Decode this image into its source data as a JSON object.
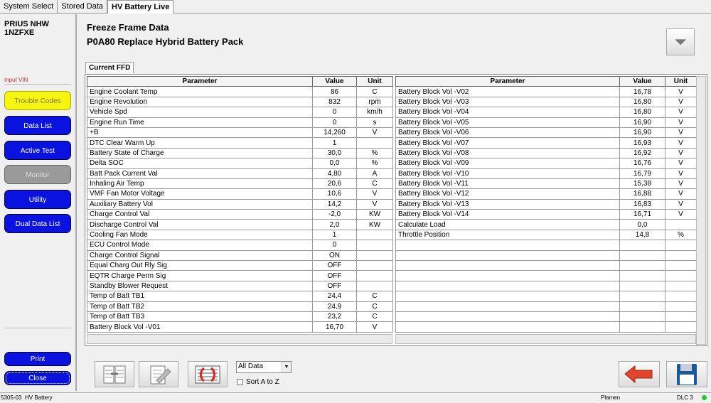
{
  "tabs": [
    {
      "label": "System Select"
    },
    {
      "label": "Stored Data"
    },
    {
      "label": "HV Battery Live",
      "active": true
    }
  ],
  "sidebar": {
    "vehicle_line1": "PRIUS NHW",
    "vehicle_line2": "1NZFXE",
    "input_vin": "Input VIN",
    "buttons": [
      {
        "label": "Trouble Codes",
        "style": "yellow"
      },
      {
        "label": "Data List"
      },
      {
        "label": "Active Test"
      },
      {
        "label": "Monitor",
        "style": "disabled"
      },
      {
        "label": "Utility"
      },
      {
        "label": "Dual Data List"
      }
    ],
    "print": "Print",
    "close": "Close"
  },
  "header": {
    "title": "Freeze Frame Data",
    "subtitle": "P0A80 Replace Hybrid Battery Pack",
    "filter_icon": "funnel-icon"
  },
  "ffd_tab": "Current FFD",
  "columns": {
    "parameter": "Parameter",
    "value": "Value",
    "unit": "Unit"
  },
  "left_rows": [
    [
      "Engine Coolant Temp",
      "86",
      "C"
    ],
    [
      "Engine Revolution",
      "832",
      "rpm"
    ],
    [
      "Vehicle Spd",
      "0",
      "km/h"
    ],
    [
      "Engine Run Time",
      "0",
      "s"
    ],
    [
      "+B",
      "14,260",
      "V"
    ],
    [
      "DTC Clear Warm Up",
      "1",
      ""
    ],
    [
      "Battery State of Charge",
      "30,0",
      "%"
    ],
    [
      "Delta SOC",
      "0,0",
      "%"
    ],
    [
      "Batt Pack Current Val",
      "4,80",
      "A"
    ],
    [
      "Inhaling Air Temp",
      "20,6",
      "C"
    ],
    [
      "VMF Fan Motor Voltage",
      "10,6",
      "V"
    ],
    [
      "Auxiliary Battery Vol",
      "14,2",
      "V"
    ],
    [
      "Charge Control Val",
      "-2,0",
      "KW"
    ],
    [
      "Discharge Control Val",
      "2,0",
      "KW"
    ],
    [
      "Cooling Fan Mode",
      "1",
      ""
    ],
    [
      "ECU Control Mode",
      "0",
      ""
    ],
    [
      "Charge Control Signal",
      "ON",
      ""
    ],
    [
      "Equal Charg Out Rly Sig",
      "OFF",
      ""
    ],
    [
      "EQTR Charge Perm Sig",
      "OFF",
      ""
    ],
    [
      "Standby Blower Request",
      "OFF",
      ""
    ],
    [
      "Temp of Batt TB1",
      "24,4",
      "C"
    ],
    [
      "Temp of Batt TB2",
      "24,9",
      "C"
    ],
    [
      "Temp of Batt TB3",
      "23,2",
      "C"
    ],
    [
      "Battery Block Vol -V01",
      "16,70",
      "V"
    ]
  ],
  "right_rows": [
    [
      "Battery Block Vol -V02",
      "16,78",
      "V"
    ],
    [
      "Battery Block Vol -V03",
      "16,80",
      "V"
    ],
    [
      "Battery Block Vol -V04",
      "16,80",
      "V"
    ],
    [
      "Battery Block Vol -V05",
      "16,90",
      "V"
    ],
    [
      "Battery Block Vol -V06",
      "16,90",
      "V"
    ],
    [
      "Battery Block Vol -V07",
      "16,93",
      "V"
    ],
    [
      "Battery Block Vol -V08",
      "16,92",
      "V"
    ],
    [
      "Battery Block Vol -V09",
      "16,76",
      "V"
    ],
    [
      "Battery Block Vol -V10",
      "16,79",
      "V"
    ],
    [
      "Battery Block Vol -V11",
      "15,38",
      "V"
    ],
    [
      "Battery Block Vol -V12",
      "16,88",
      "V"
    ],
    [
      "Battery Block Vol -V13",
      "16,83",
      "V"
    ],
    [
      "Battery Block Vol -V14",
      "16,71",
      "V"
    ],
    [
      "Calculate Load",
      "0,0",
      ""
    ],
    [
      "Throttle Position",
      "14,8",
      "%"
    ]
  ],
  "toolbar": {
    "select_value": "All Data",
    "sort_label": "Sort A to Z",
    "sort_checked": false
  },
  "status": {
    "code": "5305-03",
    "module": "HV Battery",
    "user": "Plamen",
    "port": "DLC 3",
    "connection_color": "#22cc22"
  }
}
